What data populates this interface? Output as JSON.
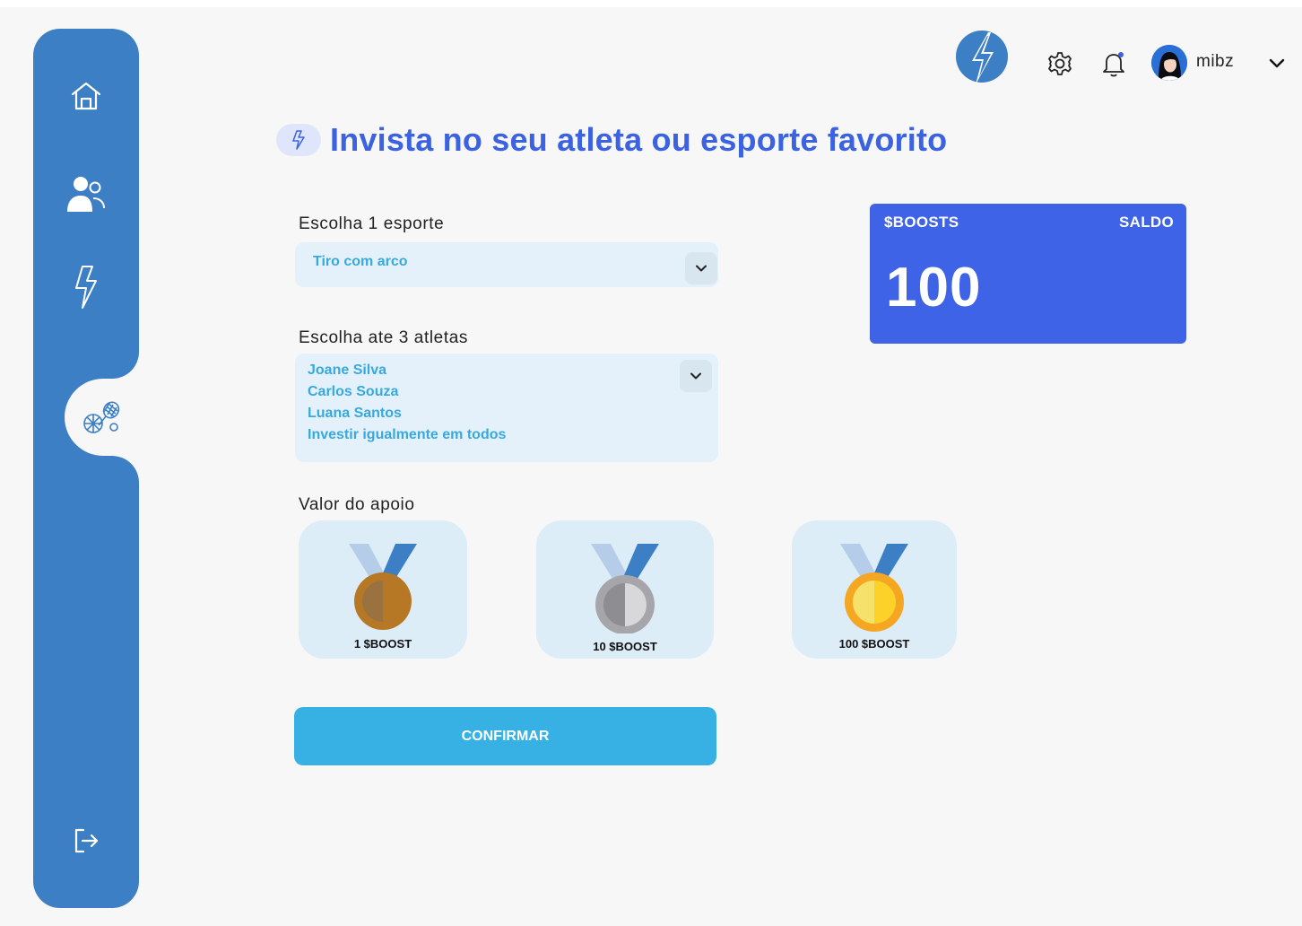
{
  "header": {
    "username": "mibz"
  },
  "page": {
    "title": "Invista no seu atleta ou esporte favorito"
  },
  "sport_select": {
    "label": "Escolha 1 esporte",
    "value": "Tiro com arco"
  },
  "athletes_select": {
    "label": "Escolha ate 3 atletas",
    "options": [
      "Joane Silva",
      "Carlos Souza",
      "Luana Santos",
      "Investir igualmente em todos"
    ]
  },
  "balance": {
    "label_left": "$BOOSTS",
    "label_right": "SALDO",
    "value": "100"
  },
  "support": {
    "label": "Valor do apoio",
    "options": [
      {
        "label": "1 $BOOST",
        "medal": "bronze"
      },
      {
        "label": "10 $BOOST",
        "medal": "silver"
      },
      {
        "label": "100 $BOOST",
        "medal": "gold"
      }
    ]
  },
  "confirm_label": "CONFIRMAR",
  "icons": {
    "sidebar": [
      "home-icon",
      "users-icon",
      "lightning-icon",
      "sports-icon",
      "logout-icon"
    ],
    "header": [
      "lightning-logo",
      "gear-icon",
      "bell-icon",
      "chevron-down-icon"
    ]
  },
  "colors": {
    "sidebar": "#3c7fc4",
    "accent": "#3b62e0",
    "balance_card": "#3e63e6",
    "confirm_button": "#37b1e4",
    "select_text": "#38a9de"
  }
}
